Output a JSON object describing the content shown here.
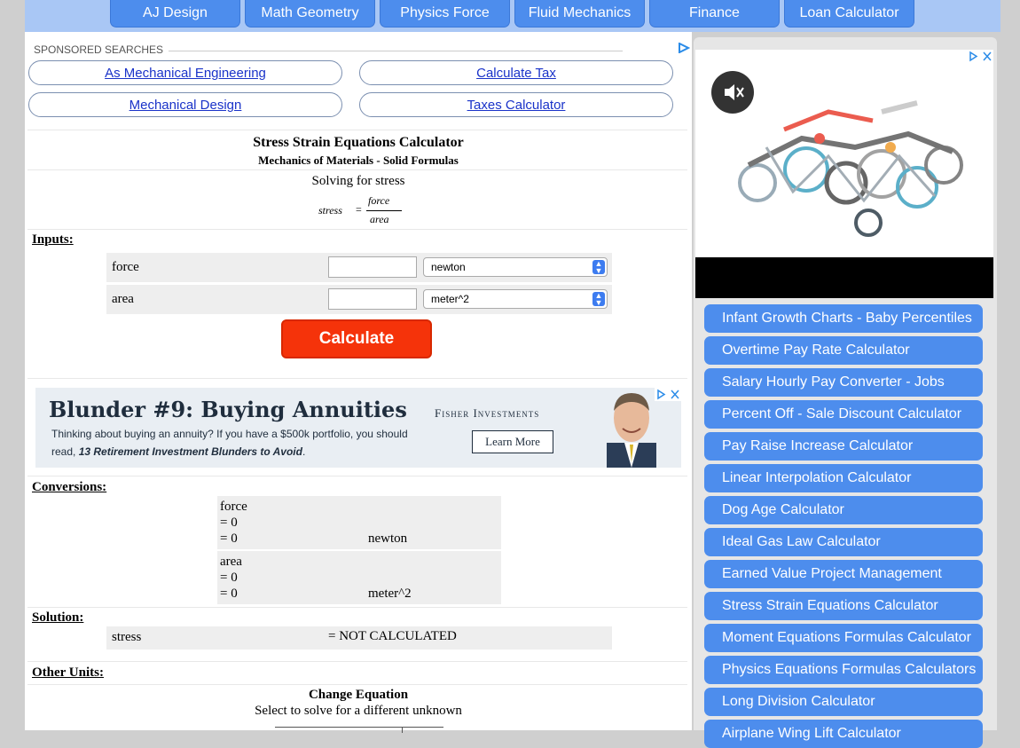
{
  "topnav": {
    "items": [
      "AJ Design",
      "Math Geometry",
      "Physics Force",
      "Fluid Mechanics",
      "Finance",
      "Loan Calculator"
    ]
  },
  "sponsored": {
    "label": "SPONSORED SEARCHES",
    "links": [
      "As Mechanical Engineering",
      "Calculate Tax",
      "Mechanical Design",
      "Taxes Calculator"
    ]
  },
  "calculator": {
    "title": "Stress Strain Equations Calculator",
    "subtitle": "Mechanics of Materials - Solid Formulas",
    "solving_for": "Solving for stress",
    "formula": {
      "lhs": "stress",
      "eq": "=",
      "numerator": "force",
      "denominator": "area"
    },
    "inputs_heading": "Inputs:",
    "inputs": [
      {
        "label": "force",
        "value": "",
        "unit": "newton"
      },
      {
        "label": "area",
        "value": "",
        "unit": "meter^2"
      }
    ],
    "calculate_label": "Calculate"
  },
  "ad_banner": {
    "headline": "Blunder #9: Buying Annuities",
    "brand": "Fisher Investments",
    "body_line1": "Thinking about buying an annuity? If you have a $500k portfolio, you should",
    "body_line2_prefix": "read, ",
    "body_line2_bold": "13 Retirement Investment Blunders to Avoid",
    "body_line2_suffix": ".",
    "cta": "Learn More"
  },
  "conversions": {
    "heading": "Conversions:",
    "items": [
      {
        "name": "force",
        "line1": "= 0",
        "line2": "= 0",
        "unit": "newton"
      },
      {
        "name": "area",
        "line1": "= 0",
        "line2": "= 0",
        "unit": "meter^2"
      }
    ]
  },
  "solution": {
    "heading": "Solution:",
    "label": "stress",
    "value": "= NOT CALCULATED"
  },
  "other_units": {
    "heading": "Other Units:"
  },
  "change_equation": {
    "title": "Change Equation",
    "subtitle": "Select to solve for a different unknown"
  },
  "sidebar": {
    "links": [
      "Infant Growth Charts - Baby Percentiles",
      "Overtime Pay Rate Calculator",
      "Salary Hourly Pay Converter - Jobs",
      "Percent Off - Sale Discount Calculator",
      "Pay Raise Increase Calculator",
      "Linear Interpolation Calculator",
      "Dog Age Calculator",
      "Ideal Gas Law Calculator",
      "Earned Value Project Management",
      "Stress Strain Equations Calculator",
      "Moment Equations Formulas Calculator",
      "Physics Equations Formulas Calculators",
      "Long Division Calculator",
      "Airplane Wing Lift Calculator"
    ]
  },
  "colors": {
    "nav_button": "#4d8ded",
    "nav_bar": "#a9c7f5",
    "calculate_button": "#f5330a",
    "link_text": "#1a33c9"
  }
}
